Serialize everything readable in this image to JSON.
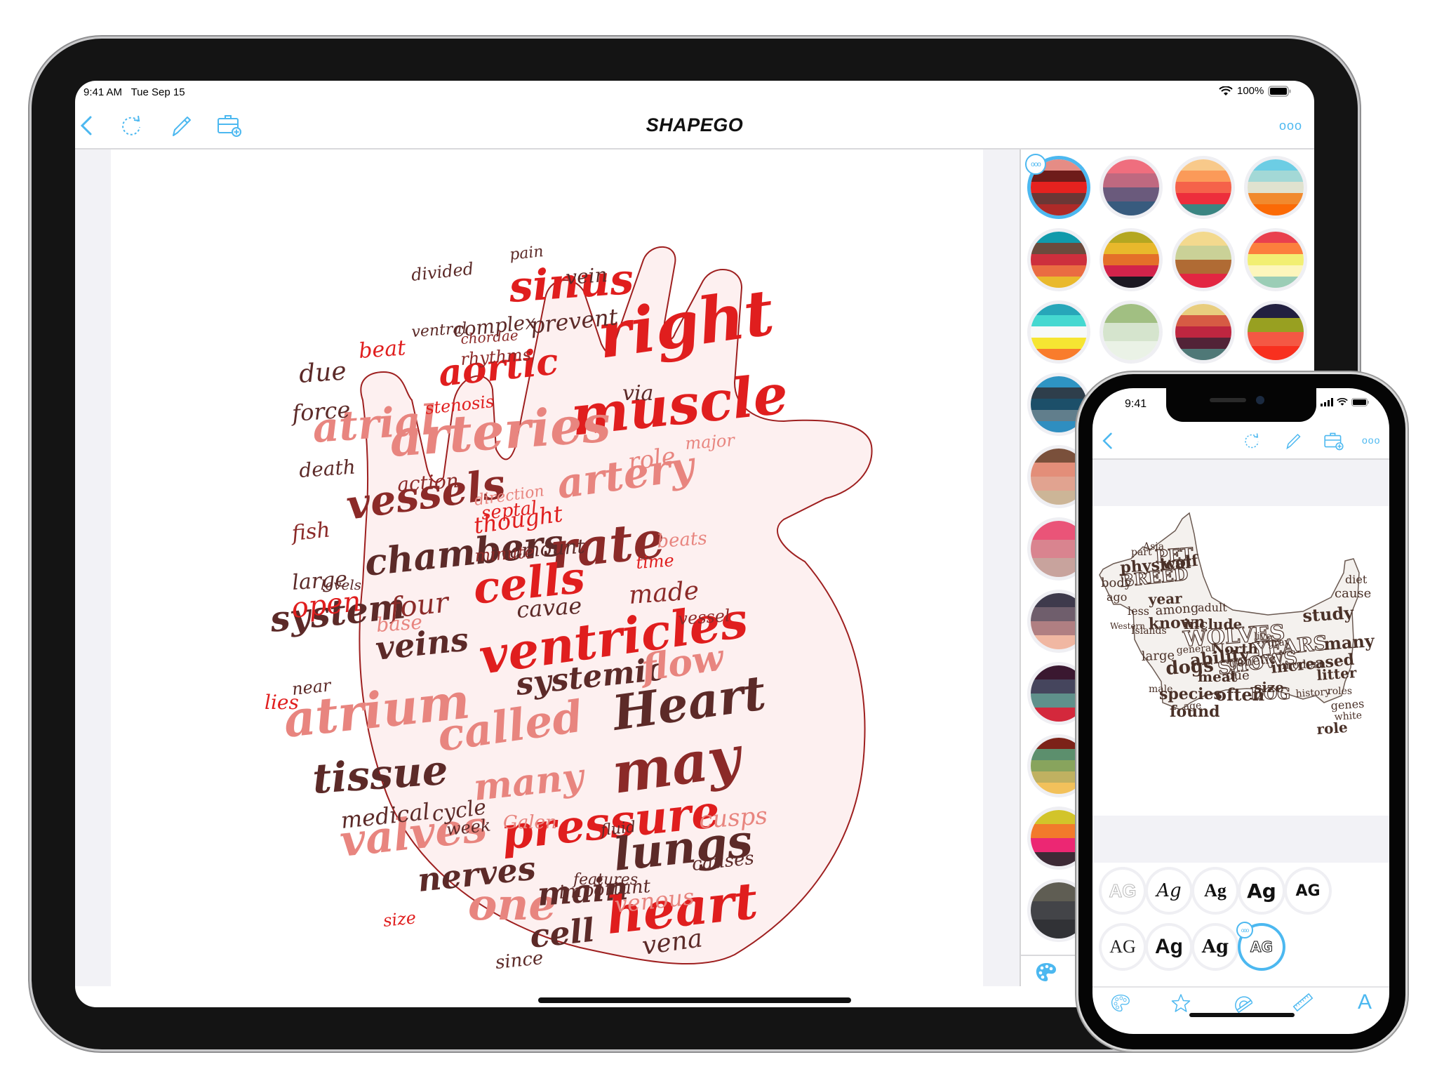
{
  "ipad": {
    "status_bar": {
      "time": "9:41 AM",
      "date": "Tue Sep 15",
      "battery": "100%"
    },
    "nav": {
      "title": "SHAPEGO",
      "icons": [
        "back-chevron-icon",
        "refresh-icon",
        "pen-icon",
        "toolbox-add-icon",
        "more-icon"
      ],
      "more_label": "ooo"
    },
    "palette_sidebar": {
      "selected_index": 0,
      "swatches": [
        {
          "colors": [
            "#e58c85",
            "#6e1c1a",
            "#e5221f",
            "#6b3735",
            "#ae2a28"
          ]
        },
        {
          "colors": [
            "#ef6e7e",
            "#bf6980",
            "#6a5a7c",
            "#385b7e"
          ]
        },
        {
          "colors": [
            "#f8c98a",
            "#fb9a59",
            "#f5624a",
            "#ed2e3c",
            "#3b8582"
          ]
        },
        {
          "colors": [
            "#6ccde4",
            "#a3d8d6",
            "#e0e2cf",
            "#f18a2e",
            "#fb6a06"
          ]
        },
        {
          "colors": [
            "#109aab",
            "#6b4a3d",
            "#cd2f3d",
            "#ea6c42",
            "#e9b92d"
          ]
        },
        {
          "colors": [
            "#b4a721",
            "#e8b82c",
            "#e46f29",
            "#d2234b",
            "#1b1822"
          ]
        },
        {
          "colors": [
            "#f3d98e",
            "#cad197",
            "#b06b34",
            "#e32642"
          ]
        },
        {
          "colors": [
            "#e9404e",
            "#fc7f3d",
            "#f2ef73",
            "#fdf6bc",
            "#9bcdb6"
          ]
        },
        {
          "colors": [
            "#27a6b9",
            "#45d8d0",
            "#f7f9f9",
            "#f6e532",
            "#f97c2c"
          ]
        },
        {
          "colors": [
            "#a1bf82",
            "#d5e4cd",
            "#eaf2e6"
          ]
        },
        {
          "colors": [
            "#e8cd7e",
            "#d65b44",
            "#be2640",
            "#522337",
            "#4f7877"
          ]
        },
        {
          "colors": [
            "#222040",
            "#98a021",
            "#f45844",
            "#f8301f"
          ]
        },
        {
          "colors": [
            "#2e94c3",
            "#2e3e4b",
            "#1c4f69",
            "#617e8c",
            "#2f8ec0"
          ]
        },
        {
          "colors": [
            "#7a503b",
            "#e38e79",
            "#e1a390",
            "#ccb597"
          ]
        },
        {
          "colors": [
            "#ea5478",
            "#d9848f",
            "#c8a39d"
          ]
        },
        {
          "colors": [
            "#3e3a4c",
            "#6f5e6c",
            "#b07f82",
            "#f0b7a2"
          ]
        },
        {
          "colors": [
            "#3a1830",
            "#45455d",
            "#5f908b",
            "#d4283c"
          ]
        },
        {
          "colors": [
            "#7c2218",
            "#5c8f6d",
            "#88a45d",
            "#c0b161",
            "#f2c15b"
          ]
        },
        {
          "colors": [
            "#d2c42a",
            "#f27a2b",
            "#ec2773",
            "#3d2a36"
          ]
        },
        {
          "colors": [
            "#5f5d53",
            "#434448",
            "#313236"
          ]
        }
      ],
      "more_label": "ooo",
      "tab_icon": "palette-icon"
    },
    "wordcloud": {
      "shape": "anatomical-heart",
      "colors": {
        "dark": "#5c2a28",
        "maroon": "#8b2a28",
        "red": "#e01e1e",
        "pink": "#e8857f",
        "fill": "#fdf0f0",
        "outline": "#9e1f1f"
      },
      "words": [
        {
          "t": "right",
          "c": "red"
        },
        {
          "t": "muscle",
          "c": "red"
        },
        {
          "t": "sinus",
          "c": "red"
        },
        {
          "t": "aortic",
          "c": "red"
        },
        {
          "t": "atrial",
          "c": "pink"
        },
        {
          "t": "arteries",
          "c": "pink"
        },
        {
          "t": "artery",
          "c": "pink"
        },
        {
          "t": "vessels",
          "c": "maroon"
        },
        {
          "t": "chambers",
          "c": "dark"
        },
        {
          "t": "rate",
          "c": "maroon"
        },
        {
          "t": "cells",
          "c": "red"
        },
        {
          "t": "ventricles",
          "c": "red"
        },
        {
          "t": "system",
          "c": "dark"
        },
        {
          "t": "veins",
          "c": "dark"
        },
        {
          "t": "systemic",
          "c": "dark"
        },
        {
          "t": "flow",
          "c": "pink"
        },
        {
          "t": "atrium",
          "c": "pink"
        },
        {
          "t": "called",
          "c": "pink"
        },
        {
          "t": "Heart",
          "c": "dark"
        },
        {
          "t": "tissue",
          "c": "dark"
        },
        {
          "t": "may",
          "c": "maroon"
        },
        {
          "t": "many",
          "c": "pink"
        },
        {
          "t": "valves",
          "c": "pink"
        },
        {
          "t": "pressure",
          "c": "red"
        },
        {
          "t": "nerves",
          "c": "dark"
        },
        {
          "t": "one",
          "c": "pink"
        },
        {
          "t": "main",
          "c": "dark"
        },
        {
          "t": "lungs",
          "c": "dark"
        },
        {
          "t": "heart",
          "c": "red"
        },
        {
          "t": "cell",
          "c": "dark"
        },
        {
          "t": "vena",
          "c": "dark"
        },
        {
          "t": "venous",
          "c": "pink"
        },
        {
          "t": "cusps",
          "c": "pink"
        },
        {
          "t": "causes",
          "c": "dark"
        },
        {
          "t": "four",
          "c": "maroon"
        },
        {
          "t": "open",
          "c": "red"
        },
        {
          "t": "large",
          "c": "dark"
        },
        {
          "t": "made",
          "c": "maroon"
        },
        {
          "t": "cavae",
          "c": "dark"
        },
        {
          "t": "amount",
          "c": "dark"
        },
        {
          "t": "thought",
          "c": "red"
        },
        {
          "t": "minute",
          "c": "maroon"
        },
        {
          "t": "death",
          "c": "dark"
        },
        {
          "t": "fish",
          "c": "maroon"
        },
        {
          "t": "force",
          "c": "dark"
        },
        {
          "t": "due",
          "c": "dark"
        },
        {
          "t": "beat",
          "c": "red"
        },
        {
          "t": "prevent",
          "c": "dark"
        },
        {
          "t": "vein",
          "c": "dark"
        },
        {
          "t": "via",
          "c": "dark"
        },
        {
          "t": "role",
          "c": "pink"
        },
        {
          "t": "major",
          "c": "pink"
        },
        {
          "t": "action",
          "c": "maroon"
        },
        {
          "t": "medical",
          "c": "dark"
        },
        {
          "t": "cycle",
          "c": "dark"
        },
        {
          "t": "week",
          "c": "dark"
        },
        {
          "t": "Galen",
          "c": "pink"
        },
        {
          "t": "fluid",
          "c": "dark"
        },
        {
          "t": "important",
          "c": "dark"
        },
        {
          "t": "since",
          "c": "dark"
        },
        {
          "t": "lies",
          "c": "red"
        },
        {
          "t": "near",
          "c": "dark"
        },
        {
          "t": "base",
          "c": "pink"
        },
        {
          "t": "time",
          "c": "red"
        },
        {
          "t": "beats",
          "c": "pink"
        },
        {
          "t": "vessel",
          "c": "maroon"
        },
        {
          "t": "complex",
          "c": "dark"
        },
        {
          "t": "rhythms",
          "c": "maroon"
        },
        {
          "t": "chordae",
          "c": "maroon"
        },
        {
          "t": "divided",
          "c": "dark"
        },
        {
          "t": "ventral",
          "c": "dark"
        },
        {
          "t": "pain",
          "c": "dark"
        },
        {
          "t": "size",
          "c": "red"
        },
        {
          "t": "features",
          "c": "dark"
        },
        {
          "t": "septal",
          "c": "red"
        },
        {
          "t": "direction",
          "c": "pink"
        },
        {
          "t": "levels",
          "c": "dark"
        },
        {
          "t": "stenosis",
          "c": "red"
        }
      ]
    }
  },
  "iphone": {
    "status_bar": {
      "time": "9:41"
    },
    "nav": {
      "icons": [
        "back-chevron-icon",
        "refresh-icon",
        "pen-icon",
        "toolbox-add-icon",
        "more-icon"
      ],
      "more_label": "ooo"
    },
    "wordcloud": {
      "shape": "scottish-terrier",
      "colors": {
        "text": "#4a3128",
        "fill": "#f4f1ee",
        "outline": "#6b5a52"
      },
      "words": [
        {
          "t": "WOLVES",
          "style": "outline"
        },
        {
          "t": "YEARS",
          "style": "outline"
        },
        {
          "t": "SHOWS",
          "style": "outline"
        },
        {
          "t": "BREED",
          "style": "outline"
        },
        {
          "t": "PET",
          "style": "outline"
        },
        {
          "t": "DOG",
          "style": "outline"
        },
        {
          "t": "study"
        },
        {
          "t": "many"
        },
        {
          "t": "dogs"
        },
        {
          "t": "ability"
        },
        {
          "t": "meat"
        },
        {
          "t": "due"
        },
        {
          "t": "species"
        },
        {
          "t": "often"
        },
        {
          "t": "size"
        },
        {
          "t": "increased"
        },
        {
          "t": "found"
        },
        {
          "t": "year"
        },
        {
          "t": "among"
        },
        {
          "t": "known"
        },
        {
          "t": "include"
        },
        {
          "t": "physical"
        },
        {
          "t": "wolf"
        },
        {
          "t": "body"
        },
        {
          "t": "ago"
        },
        {
          "t": "part"
        },
        {
          "t": "North"
        },
        {
          "t": "genetic"
        },
        {
          "t": "large"
        },
        {
          "t": "general"
        },
        {
          "t": "litter"
        },
        {
          "t": "roles"
        },
        {
          "t": "role"
        },
        {
          "t": "white"
        },
        {
          "t": "genes"
        },
        {
          "t": "modern"
        },
        {
          "t": "history"
        },
        {
          "t": "live"
        },
        {
          "t": "gray"
        },
        {
          "t": "diet"
        },
        {
          "t": "cause"
        },
        {
          "t": "less"
        },
        {
          "t": "adult"
        },
        {
          "t": "Islands"
        },
        {
          "t": "Asia"
        },
        {
          "t": "male"
        },
        {
          "t": "age"
        },
        {
          "t": "Western"
        }
      ]
    },
    "font_picker": {
      "selected_index": 8,
      "more_label": "ooo",
      "fonts": [
        {
          "sample": "AG",
          "style": "outline"
        },
        {
          "sample": "Ag",
          "style": "script"
        },
        {
          "sample": "Ag",
          "style": "serif-bold"
        },
        {
          "sample": "Ag",
          "style": "heavy"
        },
        {
          "sample": "AG",
          "style": "heavy-caps"
        },
        {
          "sample": "AG",
          "style": "thin-serif"
        },
        {
          "sample": "Ag",
          "style": "condensed-bold"
        },
        {
          "sample": "Ag",
          "style": "slab-bold"
        },
        {
          "sample": "AG",
          "style": "shadow-outline"
        }
      ]
    },
    "tabbar": {
      "tabs": [
        {
          "name": "palette",
          "icon": "palette-icon"
        },
        {
          "name": "shapes",
          "icon": "star-icon"
        },
        {
          "name": "layout",
          "icon": "protractor-icon"
        },
        {
          "name": "size",
          "icon": "ruler-icon"
        },
        {
          "name": "fonts",
          "icon": "font-icon",
          "label": "A",
          "active": true
        }
      ]
    }
  }
}
